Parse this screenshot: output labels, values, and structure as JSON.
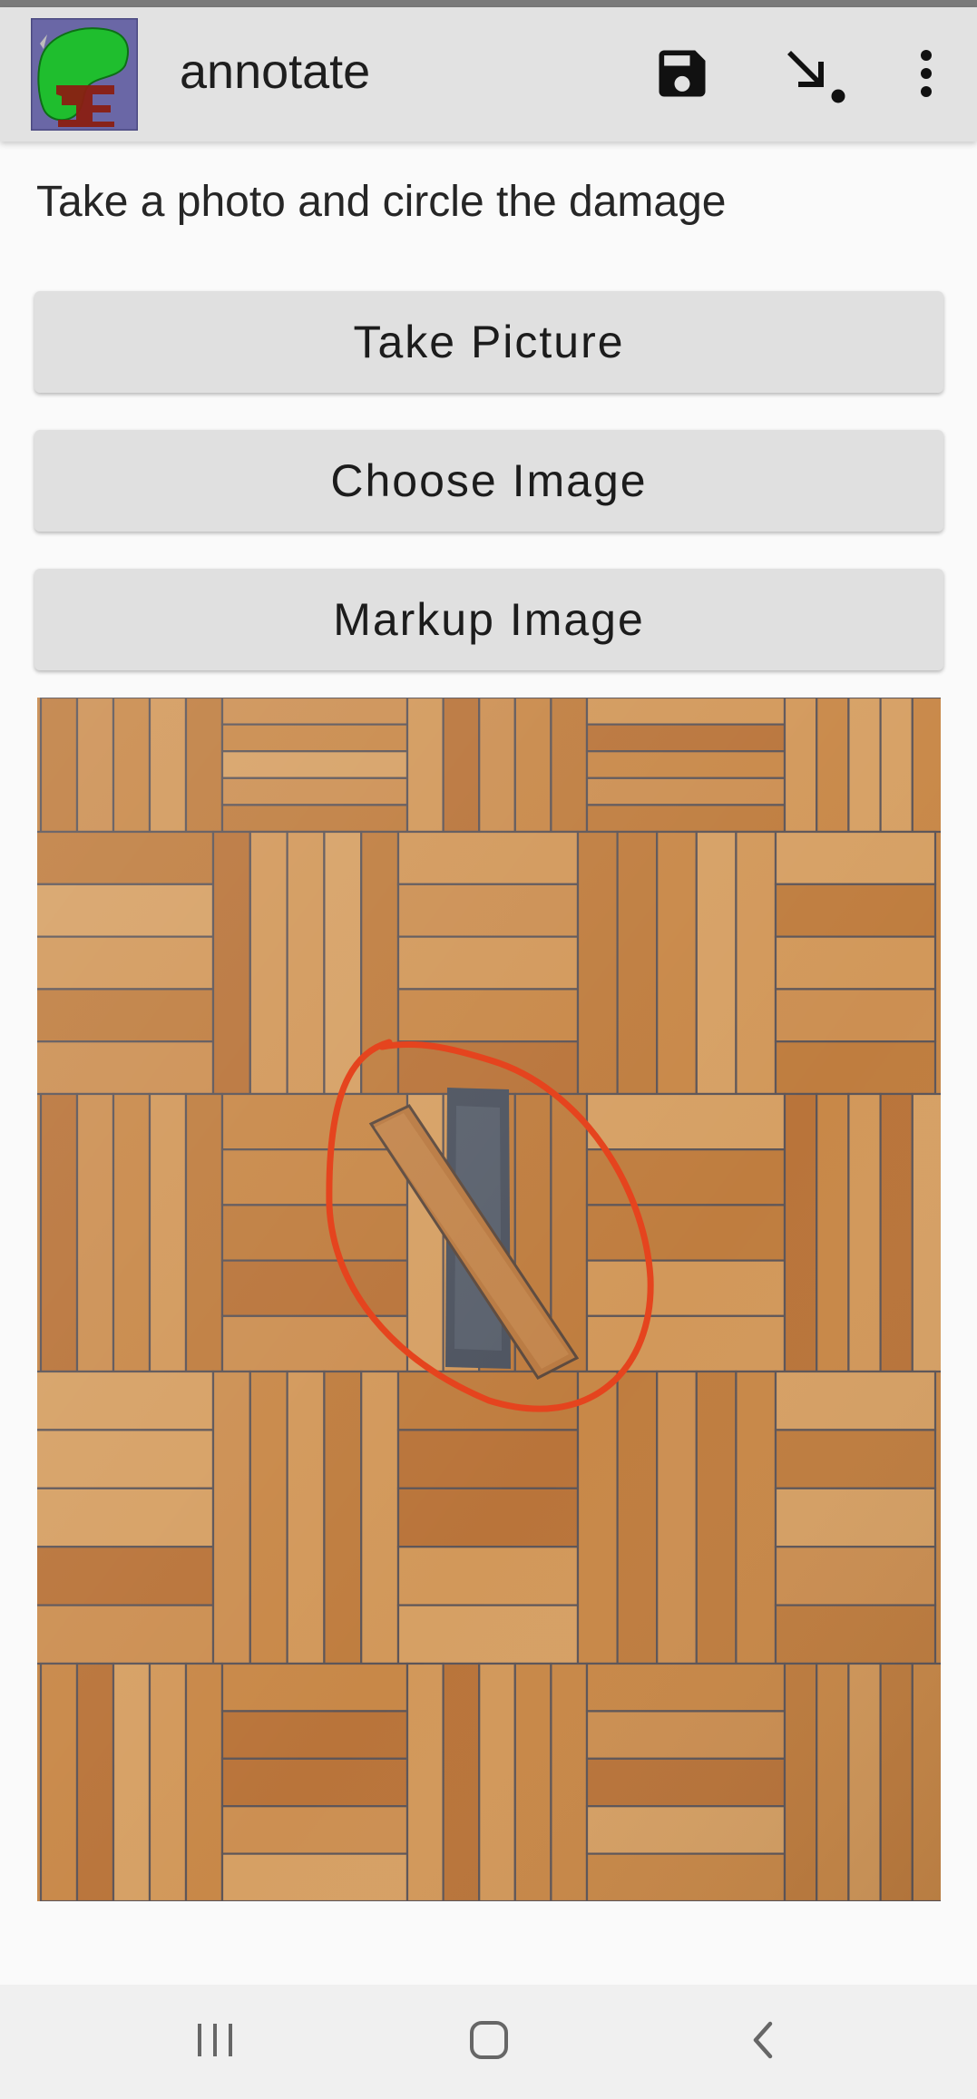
{
  "app_bar": {
    "title": "annotate",
    "actions": [
      {
        "name": "save",
        "icon": "save-icon"
      },
      {
        "name": "download",
        "icon": "download-arrow-icon"
      },
      {
        "name": "more",
        "icon": "more-vert-icon"
      }
    ]
  },
  "main": {
    "prompt": "Take a photo and circle the damage",
    "buttons": {
      "take_picture": "Take Picture",
      "choose_image": "Choose Image",
      "markup_image": "Markup Image"
    },
    "photo": {
      "subject": "damaged parquet floor with loose plank",
      "annotation": "red-hand-drawn-circle",
      "annotation_color": "#e5441e"
    }
  },
  "nav_bar": {
    "buttons": [
      {
        "name": "recents",
        "icon": "recents-icon"
      },
      {
        "name": "home",
        "icon": "home-icon"
      },
      {
        "name": "back",
        "icon": "back-chevron-icon"
      }
    ]
  },
  "colors": {
    "app_bar_bg": "#e2e2e2",
    "button_bg": "#e0e0e0",
    "page_bg": "#fafafa",
    "nav_bar_bg": "#f0f0f0",
    "logo_green": "#1fbe2e",
    "logo_red": "#8a1f12",
    "logo_bg": "#6a67a6"
  }
}
